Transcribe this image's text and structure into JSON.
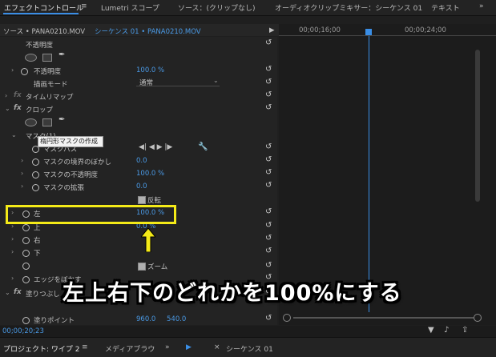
{
  "tabs": {
    "effect_controls": "エフェクトコントロール",
    "menu": "≡",
    "lumetri": "Lumetri スコープ",
    "source": "ソース：(クリップなし)",
    "audio_mixer": "オーディオクリップミキサー：シーケンス 01",
    "text": "テキスト",
    "more": "»"
  },
  "source_bar": {
    "source": "ソース • PANA0210.MOV",
    "sequence": "シーケンス 01 • PANA0210.MOV",
    "play": "▶"
  },
  "timeline": {
    "time1": "00;00;16;00",
    "time2": "00;00;24;00"
  },
  "opacity": {
    "section": "不透明度",
    "label": "不透明度",
    "value": "100.0 %",
    "blend_label": "描画モード",
    "blend_value": "通常"
  },
  "time_remap": "タイムリマップ",
  "crop": {
    "label": "クロップ",
    "mask_label": "マスク(1)",
    "tooltip": "楕円形マスクの作成",
    "mask_path": "マスクパス",
    "feather": "マスクの境界のぼかし",
    "feather_value": "0.0",
    "mask_opacity": "マスクの不透明度",
    "mask_opacity_value": "100.0 %",
    "expansion": "マスクの拡張",
    "expansion_value": "0.0",
    "inverted": "反転",
    "left": "左",
    "left_value": "100.0 %",
    "top": "上",
    "top_value": "0.0 %",
    "right": "右",
    "bottom": "下",
    "zoom_label": "ズーム",
    "edge": "エッジをぼかす"
  },
  "fill": {
    "label": "塗りつぶし",
    "point": "塗りポイント",
    "x": "960.0",
    "y": "540.0"
  },
  "timecode": "00;00;20;23",
  "annotation": "左上右下のどれかを100%にする",
  "bottom_tabs": {
    "project": "プロジェクト: ワイプ 2",
    "media_browser": "メディアブラウ",
    "more": "»",
    "sequence": "シーケンス 01"
  },
  "colors": {
    "accent": "#3a8ee6",
    "highlight": "#f4ea18"
  }
}
